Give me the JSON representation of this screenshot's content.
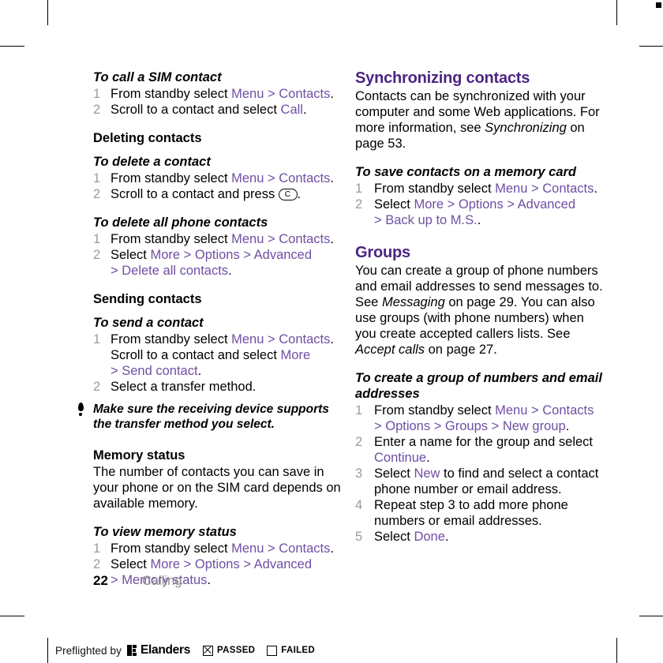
{
  "page": {
    "folio": "22",
    "running_head": "Calling"
  },
  "left_column": {
    "sec_call_sim": {
      "heading": "To call a SIM contact",
      "steps": [
        {
          "num": "1",
          "parts": [
            {
              "t": "From standby select ",
              "s": "plain"
            },
            {
              "t": "Menu",
              "s": "link"
            },
            {
              "t": " > ",
              "s": "link"
            },
            {
              "t": "Contacts",
              "s": "link"
            },
            {
              "t": ".",
              "s": "plain"
            }
          ]
        },
        {
          "num": "2",
          "parts": [
            {
              "t": "Scroll to a contact and select ",
              "s": "plain"
            },
            {
              "t": "Call",
              "s": "link"
            },
            {
              "t": ".",
              "s": "plain"
            }
          ]
        }
      ]
    },
    "sec_deleting": {
      "heading": "Deleting contacts"
    },
    "sec_delete_contact": {
      "heading": "To delete a contact",
      "steps": [
        {
          "num": "1",
          "parts": [
            {
              "t": "From standby select ",
              "s": "plain"
            },
            {
              "t": "Menu",
              "s": "link"
            },
            {
              "t": " > ",
              "s": "link"
            },
            {
              "t": "Contacts",
              "s": "link"
            },
            {
              "t": ".",
              "s": "plain"
            }
          ]
        },
        {
          "num": "2",
          "parts": [
            {
              "t": "Scroll to a contact and press ",
              "s": "plain"
            },
            {
              "t": "C",
              "s": "key"
            },
            {
              "t": ".",
              "s": "plain"
            }
          ]
        }
      ]
    },
    "sec_delete_all": {
      "heading": "To delete all phone contacts",
      "steps": [
        {
          "num": "1",
          "parts": [
            {
              "t": "From standby select ",
              "s": "plain"
            },
            {
              "t": "Menu",
              "s": "link"
            },
            {
              "t": " > ",
              "s": "link"
            },
            {
              "t": "Contacts",
              "s": "link"
            },
            {
              "t": ".",
              "s": "plain"
            }
          ]
        },
        {
          "num": "2",
          "parts": [
            {
              "t": "Select ",
              "s": "plain"
            },
            {
              "t": "More",
              "s": "link"
            },
            {
              "t": " > ",
              "s": "link"
            },
            {
              "t": "Options",
              "s": "link"
            },
            {
              "t": " > ",
              "s": "link"
            },
            {
              "t": "Advanced",
              "s": "link"
            },
            {
              "t": "\n",
              "s": "br"
            },
            {
              "t": "> ",
              "s": "link"
            },
            {
              "t": "Delete all contacts",
              "s": "link"
            },
            {
              "t": ".",
              "s": "plain"
            }
          ]
        }
      ]
    },
    "sec_sending": {
      "heading": "Sending contacts"
    },
    "sec_send_contact": {
      "heading": "To send a contact",
      "steps": [
        {
          "num": "1",
          "parts": [
            {
              "t": "From standby select ",
              "s": "plain"
            },
            {
              "t": "Menu",
              "s": "link"
            },
            {
              "t": " > ",
              "s": "link"
            },
            {
              "t": "Contacts",
              "s": "link"
            },
            {
              "t": ". ",
              "s": "plain"
            },
            {
              "t": "\n",
              "s": "br"
            },
            {
              "t": "Scroll to a contact and select ",
              "s": "plain"
            },
            {
              "t": "More",
              "s": "link"
            },
            {
              "t": "\n",
              "s": "br"
            },
            {
              "t": "> ",
              "s": "link"
            },
            {
              "t": "Send contact",
              "s": "link"
            },
            {
              "t": ".",
              "s": "plain"
            }
          ]
        },
        {
          "num": "2",
          "parts": [
            {
              "t": "Select a transfer method.",
              "s": "plain"
            }
          ]
        }
      ]
    },
    "note": {
      "icon": "tip-exclamation-icon",
      "text": "Make sure the receiving device supports the transfer method you select."
    },
    "sec_memory_status": {
      "heading": "Memory status",
      "body": "The number of contacts you can save in your phone or on the SIM card depends on available memory."
    },
    "sec_view_memory": {
      "heading": "To view memory status",
      "steps": [
        {
          "num": "1",
          "parts": [
            {
              "t": "From standby select ",
              "s": "plain"
            },
            {
              "t": "Menu",
              "s": "link"
            },
            {
              "t": " > ",
              "s": "link"
            },
            {
              "t": "Contacts",
              "s": "link"
            },
            {
              "t": ".",
              "s": "plain"
            }
          ]
        },
        {
          "num": "2",
          "parts": [
            {
              "t": "Select ",
              "s": "plain"
            },
            {
              "t": "More",
              "s": "link"
            },
            {
              "t": " > ",
              "s": "link"
            },
            {
              "t": "Options",
              "s": "link"
            },
            {
              "t": " > ",
              "s": "link"
            },
            {
              "t": "Advanced",
              "s": "link"
            },
            {
              "t": "\n",
              "s": "br"
            },
            {
              "t": "> ",
              "s": "link"
            },
            {
              "t": "Memory status",
              "s": "link"
            },
            {
              "t": ".",
              "s": "plain"
            }
          ]
        }
      ]
    }
  },
  "right_column": {
    "sec_sync": {
      "heading": "Synchronizing contacts",
      "body_parts": [
        {
          "t": "Contacts can be synchronized with your computer and some Web applications. For more information, see ",
          "s": "plain"
        },
        {
          "t": "Synchronizing",
          "s": "italic"
        },
        {
          "t": " on page 53.",
          "s": "plain"
        }
      ]
    },
    "sec_save_memcard": {
      "heading": "To save contacts on a memory card",
      "steps": [
        {
          "num": "1",
          "parts": [
            {
              "t": "From standby select ",
              "s": "plain"
            },
            {
              "t": "Menu",
              "s": "link"
            },
            {
              "t": " > ",
              "s": "link"
            },
            {
              "t": "Contacts",
              "s": "link"
            },
            {
              "t": ".",
              "s": "plain"
            }
          ]
        },
        {
          "num": "2",
          "parts": [
            {
              "t": "Select ",
              "s": "plain"
            },
            {
              "t": "More",
              "s": "link"
            },
            {
              "t": " > ",
              "s": "link"
            },
            {
              "t": "Options",
              "s": "link"
            },
            {
              "t": " > ",
              "s": "link"
            },
            {
              "t": "Advanced",
              "s": "link"
            },
            {
              "t": "\n",
              "s": "br"
            },
            {
              "t": "> ",
              "s": "link"
            },
            {
              "t": "Back up to M.S.",
              "s": "link"
            },
            {
              "t": ".",
              "s": "plain"
            }
          ]
        }
      ]
    },
    "sec_groups": {
      "heading": "Groups",
      "body_parts": [
        {
          "t": "You can create a group of phone numbers and email addresses to send messages to. See ",
          "s": "plain"
        },
        {
          "t": "Messaging",
          "s": "italic"
        },
        {
          "t": " on page 29. You can also use groups (with phone numbers) when you create accepted callers lists. See ",
          "s": "plain"
        },
        {
          "t": "Accept calls",
          "s": "italic"
        },
        {
          "t": " on page 27.",
          "s": "plain"
        }
      ]
    },
    "sec_create_group": {
      "heading": "To create a group of numbers and email addresses",
      "steps": [
        {
          "num": "1",
          "parts": [
            {
              "t": "From standby select ",
              "s": "plain"
            },
            {
              "t": "Menu",
              "s": "link"
            },
            {
              "t": " > ",
              "s": "link"
            },
            {
              "t": "Contacts",
              "s": "link"
            },
            {
              "t": "\n",
              "s": "br"
            },
            {
              "t": "> ",
              "s": "link"
            },
            {
              "t": "Options",
              "s": "link"
            },
            {
              "t": " > ",
              "s": "link"
            },
            {
              "t": "Groups",
              "s": "link"
            },
            {
              "t": " > ",
              "s": "link"
            },
            {
              "t": "New group",
              "s": "link"
            },
            {
              "t": ".",
              "s": "plain"
            }
          ]
        },
        {
          "num": "2",
          "parts": [
            {
              "t": "Enter a name for the group and select ",
              "s": "plain"
            },
            {
              "t": "Continue",
              "s": "link"
            },
            {
              "t": ".",
              "s": "plain"
            }
          ]
        },
        {
          "num": "3",
          "parts": [
            {
              "t": "Select ",
              "s": "plain"
            },
            {
              "t": "New",
              "s": "link"
            },
            {
              "t": " to find and select a contact phone number or email address.",
              "s": "plain"
            }
          ]
        },
        {
          "num": "4",
          "parts": [
            {
              "t": "Repeat step 3 to add more phone numbers or email addresses.",
              "s": "plain"
            }
          ]
        },
        {
          "num": "5",
          "parts": [
            {
              "t": "Select ",
              "s": "plain"
            },
            {
              "t": "Done",
              "s": "link"
            },
            {
              "t": ".",
              "s": "plain"
            }
          ]
        }
      ]
    }
  },
  "preflight_bar": {
    "prefix": "Preflighted by",
    "brand": "Elanders",
    "passed_label": "PASSED",
    "failed_label": "FAILED",
    "passed_checked": true,
    "failed_checked": false
  },
  "colors": {
    "heading_purple": "#4c2583",
    "link_purple": "#6f4fa3",
    "step_number_gray": "#9b9b9b",
    "running_head_gray": "#8e8e8e"
  }
}
